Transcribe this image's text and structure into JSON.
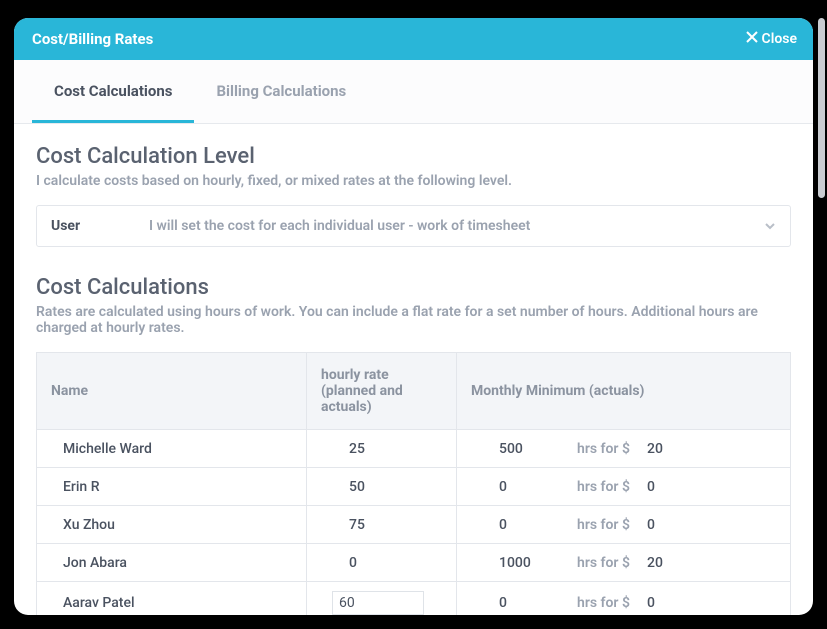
{
  "header": {
    "title": "Cost/Billing Rates",
    "close_label": "Close"
  },
  "tabs": [
    {
      "label": "Cost Calculations",
      "active": true
    },
    {
      "label": "Billing Calculations",
      "active": false
    }
  ],
  "level": {
    "title": "Cost Calculation Level",
    "desc": "I calculate costs based on hourly, fixed, or mixed rates at the following level.",
    "select_value": "User",
    "select_desc": "I will set the cost for each individual user - work of timesheet"
  },
  "calc": {
    "title": "Cost Calculations",
    "desc": "Rates are calculated using hours of work. You can include a flat rate for a set number of hours. Additional hours are charged at hourly rates."
  },
  "table": {
    "col_name": "Name",
    "col_rate": "hourly rate (planned and actuals)",
    "col_min": "Monthly Minimum (actuals)",
    "hrs_for_label": "hrs for $",
    "rows": [
      {
        "name": "Michelle Ward",
        "rate": "25",
        "min_hrs": "500",
        "min_amt": "20",
        "editing": false
      },
      {
        "name": "Erin R",
        "rate": "50",
        "min_hrs": "0",
        "min_amt": "0",
        "editing": false
      },
      {
        "name": "Xu Zhou",
        "rate": "75",
        "min_hrs": "0",
        "min_amt": "0",
        "editing": false
      },
      {
        "name": "Jon Abara",
        "rate": "0",
        "min_hrs": "1000",
        "min_amt": "20",
        "editing": false
      },
      {
        "name": "Aarav Patel",
        "rate": "60",
        "min_hrs": "0",
        "min_amt": "0",
        "editing": true
      }
    ]
  }
}
